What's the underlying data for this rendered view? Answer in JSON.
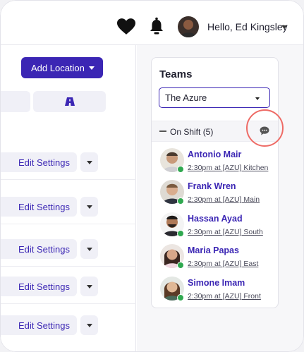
{
  "header": {
    "greeting": "Hello, Ed Kingsley",
    "icons": [
      "heart-icon",
      "bell-icon",
      "chevron-down-icon"
    ]
  },
  "left": {
    "add_location_label": "Add Location",
    "rows": [
      {
        "edit_label": "Edit Settings"
      },
      {
        "edit_label": "Edit Settings"
      },
      {
        "edit_label": "Edit Settings"
      },
      {
        "edit_label": "Edit Settings"
      },
      {
        "edit_label": "Edit Settings"
      }
    ]
  },
  "teams": {
    "title": "Teams",
    "selected_team": "The Azure",
    "shift_label": "On Shift (5)",
    "members": [
      {
        "name": "Antonio Mair",
        "detail": "2:30pm at [AZU] Kitchen",
        "status_color": "#2fa84f"
      },
      {
        "name": "Frank Wren",
        "detail": "2:30pm at [AZU] Main",
        "status_color": "#2fa84f"
      },
      {
        "name": "Hassan Ayad",
        "detail": "2:30pm at [AZU] South",
        "status_color": "#2fa84f"
      },
      {
        "name": "Maria Papas",
        "detail": "2:30pm at [AZU] East",
        "status_color": "#2fa84f"
      },
      {
        "name": "Simone Imam",
        "detail": "2:30pm at [AZU] Front",
        "status_color": "#2fa84f"
      }
    ]
  },
  "colors": {
    "accent": "#3b26b4",
    "highlight": "#ee6b66",
    "online": "#2fa84f"
  }
}
